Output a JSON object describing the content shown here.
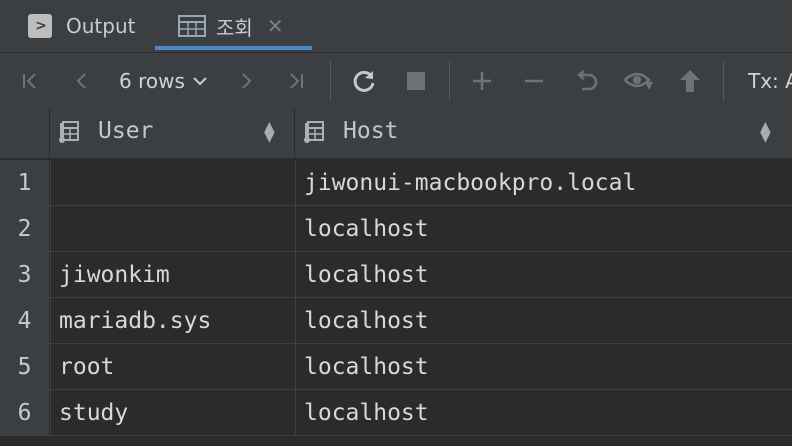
{
  "tabs": {
    "output_label": "Output",
    "result_label": "조회"
  },
  "toolbar": {
    "rows_label": "6 rows",
    "tx_label": "Tx: A"
  },
  "grid": {
    "columns": [
      "User",
      "Host"
    ],
    "rows": [
      {
        "num": "1",
        "user": "",
        "host": "jiwonui-macbookpro.local"
      },
      {
        "num": "2",
        "user": "",
        "host": "localhost"
      },
      {
        "num": "3",
        "user": "jiwonkim",
        "host": "localhost"
      },
      {
        "num": "4",
        "user": "mariadb.sys",
        "host": "localhost"
      },
      {
        "num": "5",
        "user": "root",
        "host": "localhost"
      },
      {
        "num": "6",
        "user": "study",
        "host": "localhost"
      }
    ]
  }
}
